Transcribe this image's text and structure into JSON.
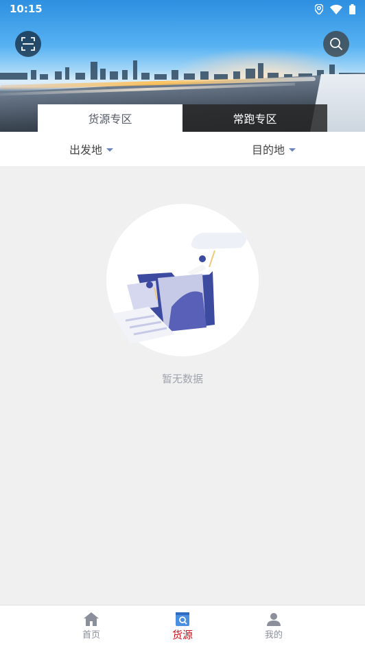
{
  "status_bar": {
    "time": "10:15",
    "icons": [
      "location-icon",
      "wifi-icon",
      "battery-icon"
    ]
  },
  "header": {
    "scan_icon": "scan-icon",
    "search_icon": "search-icon"
  },
  "tabs": [
    {
      "label": "货源专区",
      "active": true
    },
    {
      "label": "常跑专区",
      "active": false
    }
  ],
  "filters": {
    "origin": "出发地",
    "destination": "目的地"
  },
  "empty_state": {
    "message": "暂无数据"
  },
  "bottom_nav": [
    {
      "label": "首页",
      "icon": "home-icon",
      "active": false
    },
    {
      "label": "货源",
      "icon": "cargo-icon",
      "active": true
    },
    {
      "label": "我的",
      "icon": "user-icon",
      "active": false
    }
  ],
  "colors": {
    "accent": "#d0121b",
    "caret": "#6b83b7",
    "illustration_primary": "#3c4aa0"
  }
}
